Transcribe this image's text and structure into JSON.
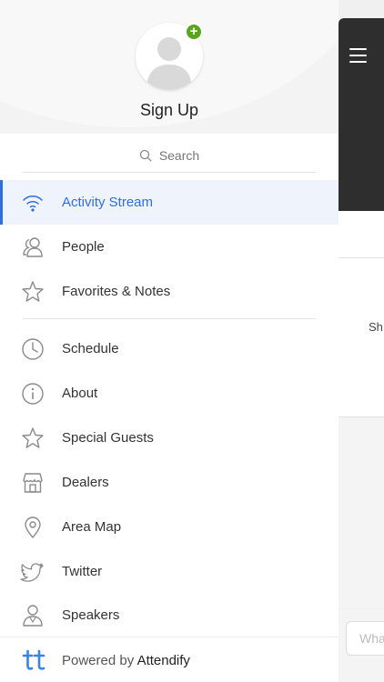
{
  "profile": {
    "signup_label": "Sign Up",
    "badge_symbol": "+",
    "badge_color": "#5aa51a"
  },
  "search": {
    "placeholder": "Search"
  },
  "menu": {
    "active_color": "#2f6fe0",
    "group1": [
      {
        "label": "Activity Stream",
        "icon": "wifi-icon",
        "active": true
      },
      {
        "label": "People",
        "icon": "people-icon"
      },
      {
        "label": "Favorites & Notes",
        "icon": "star-icon"
      }
    ],
    "group2": [
      {
        "label": "Schedule",
        "icon": "clock-icon"
      },
      {
        "label": "About",
        "icon": "info-icon"
      },
      {
        "label": "Special Guests",
        "icon": "star-icon"
      },
      {
        "label": "Dealers",
        "icon": "store-icon"
      },
      {
        "label": "Area Map",
        "icon": "map-pin-icon"
      },
      {
        "label": "Twitter",
        "icon": "twitter-icon"
      },
      {
        "label": "Speakers",
        "icon": "speaker-person-icon"
      }
    ]
  },
  "footer": {
    "prefix": "Powered by",
    "brand": "Attendify"
  },
  "background_app": {
    "card_text": "Sh",
    "input_placeholder": "Wha"
  }
}
